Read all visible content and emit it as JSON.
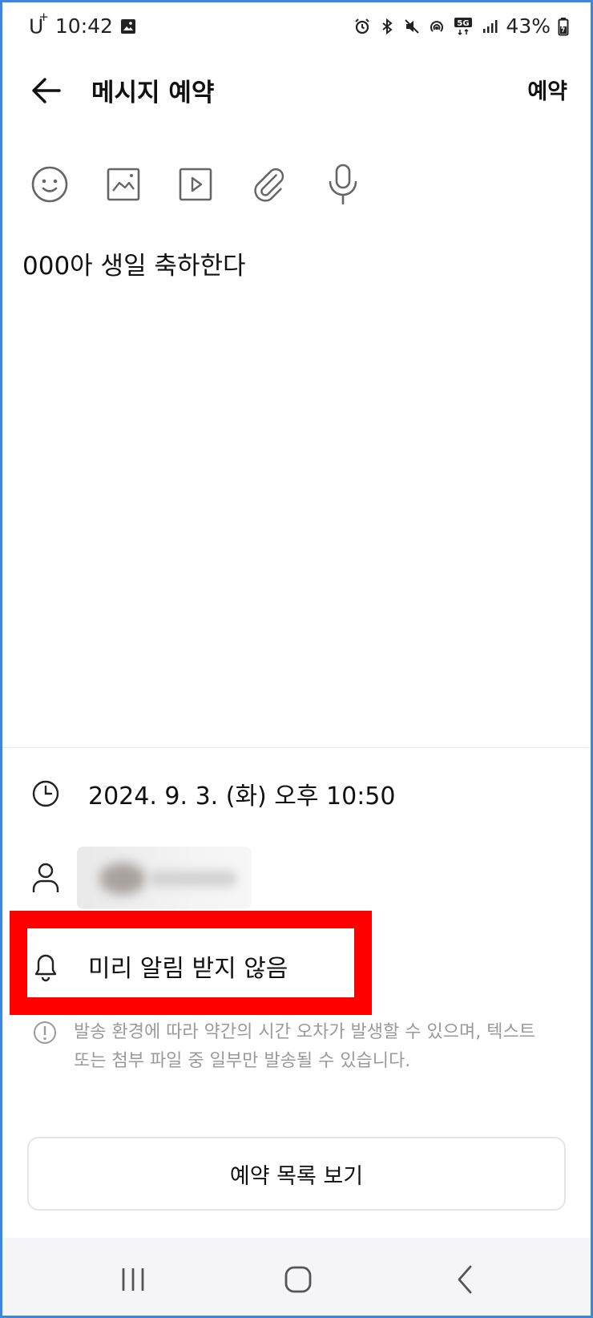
{
  "status_bar": {
    "carrier": "U",
    "carrier_sup": "+",
    "time": "10:42",
    "battery": "43%",
    "network_badge": "5G",
    "icons": [
      "image-icon",
      "alarm-icon",
      "bluetooth-icon",
      "mute-icon",
      "hotspot-icon",
      "5g-icon",
      "signal-icon",
      "battery-icon"
    ]
  },
  "header": {
    "title": "메시지 예약",
    "action_label": "예약",
    "back_icon": "arrow-left-icon"
  },
  "toolbar": {
    "icons": [
      "emoji-icon",
      "image-icon",
      "video-icon",
      "attachment-icon",
      "microphone-icon"
    ]
  },
  "message": {
    "text": "000아 생일 축하한다"
  },
  "schedule": {
    "datetime": "2024. 9. 3. (화) 오후 10:50",
    "icon": "clock-icon"
  },
  "recipient": {
    "icon": "person-icon"
  },
  "reminder": {
    "label": "미리 알림 받지 않음",
    "icon": "bell-icon"
  },
  "notice": {
    "icon": "info-icon",
    "line1": "발송 환경에 따라 약간의 시간 오차가 발생할 수 있으며, 텍스트",
    "line2": "또는 첨부 파일 중 일부만 발송될 수 있습니다."
  },
  "buttons": {
    "view_list": "예약 목록 보기"
  },
  "navbar": {
    "icons": [
      "recents-icon",
      "home-icon",
      "back-icon"
    ]
  },
  "colors": {
    "highlight": "#ff0000",
    "frame": "#3b87e0",
    "notice_text": "#9a9a9a"
  }
}
